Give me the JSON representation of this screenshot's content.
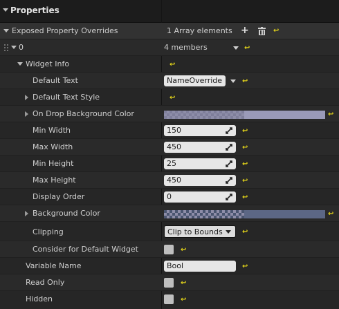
{
  "panel": {
    "title": "Properties"
  },
  "rows": {
    "exposed_overrides": {
      "label": "Exposed Property Overrides",
      "value": "1 Array elements"
    },
    "element0": {
      "label": "0",
      "value": "4 members"
    },
    "widget_info": {
      "label": "Widget Info"
    },
    "default_text": {
      "label": "Default Text",
      "value": "NameOverride"
    },
    "default_text_style": {
      "label": "Default Text Style"
    },
    "on_drop_bg_color": {
      "label": "On Drop Background Color"
    },
    "min_width": {
      "label": "Min Width",
      "value": "150"
    },
    "max_width": {
      "label": "Max Width",
      "value": "450"
    },
    "min_height": {
      "label": "Min Height",
      "value": "25"
    },
    "max_height": {
      "label": "Max Height",
      "value": "450"
    },
    "display_order": {
      "label": "Display Order",
      "value": "0"
    },
    "background_color": {
      "label": "Background Color"
    },
    "clipping": {
      "label": "Clipping",
      "value": "Clip to Bounds"
    },
    "consider_default": {
      "label": "Consider for Default Widget"
    },
    "variable_name": {
      "label": "Variable Name",
      "value": "Bool"
    },
    "read_only": {
      "label": "Read Only"
    },
    "hidden": {
      "label": "Hidden"
    }
  },
  "colors": {
    "reset_arrow": "#e2d31a",
    "on_drop_bg_swatch": "#8d8da8",
    "background_swatch": "#5c6785"
  }
}
